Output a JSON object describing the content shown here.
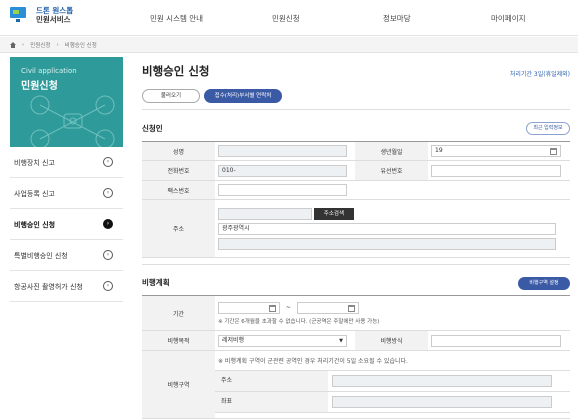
{
  "header": {
    "logo_line1": "드론 원스톱",
    "logo_line2": "민원서비스",
    "nav": [
      "민원 시스템 안내",
      "민원신청",
      "정보마당",
      "마이페이지"
    ]
  },
  "breadcrumb": [
    "민원신청",
    "비행승인 신청"
  ],
  "sidebar": {
    "hero_en": "Civil application",
    "hero_ko": "민원신청",
    "items": [
      {
        "label": "비행장치 신고",
        "active": false
      },
      {
        "label": "사업등록 신고",
        "active": false
      },
      {
        "label": "비행승인 신청",
        "active": true
      },
      {
        "label": "특별비행승인 신청",
        "active": false
      },
      {
        "label": "항공사진 촬영허가 신청",
        "active": false
      }
    ]
  },
  "main": {
    "title": "비행승인 신청",
    "deadline": "처리기간 3일(휴일제외)",
    "load_button": "불러오기",
    "dept_button": "접수(처리)부서별 연락처",
    "applicant": {
      "section_title": "신청인",
      "recent_button": "최근 입력정보",
      "name_label": "성명",
      "name_value": "",
      "birth_label": "생년월일",
      "birth_value": "19",
      "phone_label": "전화번호",
      "phone_value": "010-",
      "wired_label": "유선번호",
      "fax_label": "팩스번호",
      "address_label": "주소",
      "address_search": "주소검색",
      "address_value": "광주광역시"
    },
    "plan": {
      "section_title": "비행계획",
      "zone_button": "비행구역 설정",
      "period_label": "기간",
      "period_sep": "~",
      "period_note": "※ 기간은 6개월을 초과할 수 없습니다. (군공역은 주말에만 사용 가능)",
      "purpose_label": "비행목적",
      "purpose_value": "레저비행",
      "method_label": "비행방식",
      "zone_label": "비행구역",
      "zone_note": "※ 비행계획 구역이 군관련 공역인 경우 처리기간이 5일 소요될 수 있습니다.",
      "zone_address_label": "주소",
      "zone_coord_label": "좌표"
    }
  }
}
